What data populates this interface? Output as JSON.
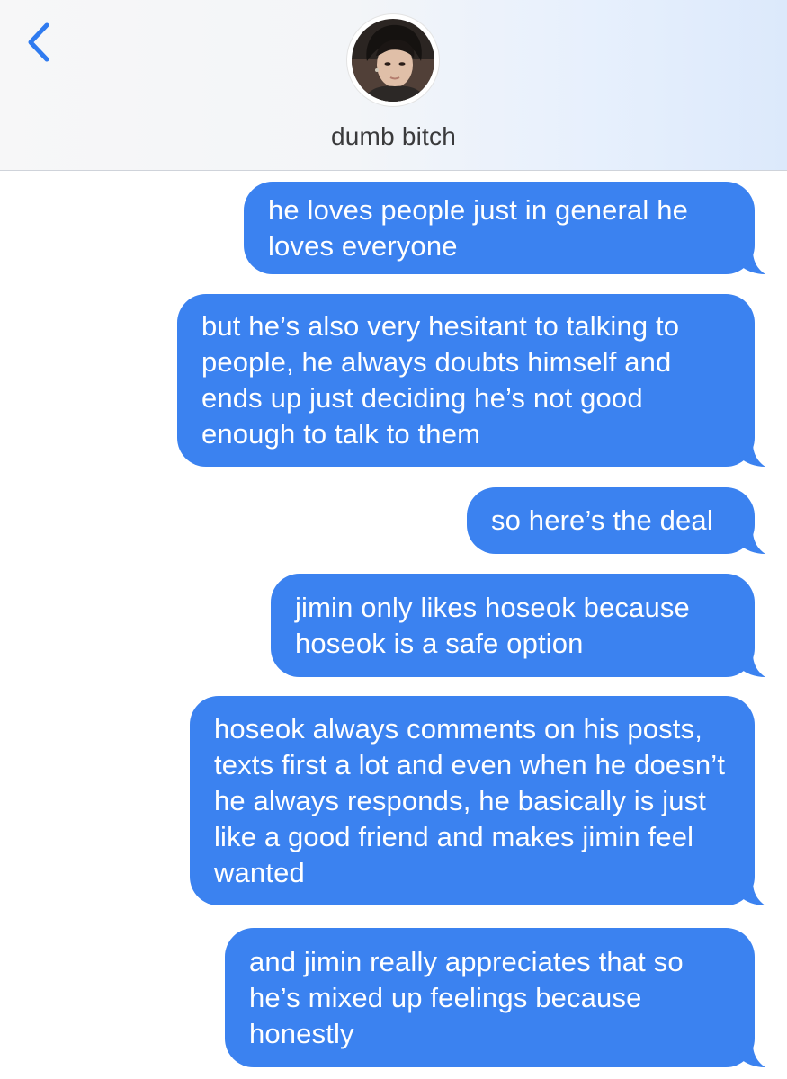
{
  "header": {
    "back_icon": "chevron-left-icon",
    "contact_name": "dumb bitch",
    "avatar_icon": "contact-avatar"
  },
  "colors": {
    "bubble_sent": "#3b82f0",
    "back_chevron": "#2f7bf0",
    "header_bg": "#f3f5f8"
  },
  "messages": [
    {
      "direction": "sent",
      "text": "he loves people just in general he loves everyone"
    },
    {
      "direction": "sent",
      "text": "but he’s also very hesitant to talking to people, he always doubts himself and ends up just deciding he’s not good enough to talk to them"
    },
    {
      "direction": "sent",
      "text": "so here’s the deal"
    },
    {
      "direction": "sent",
      "text": "jimin only likes hoseok because hoseok is a safe option"
    },
    {
      "direction": "sent",
      "text": "hoseok always comments on his posts, texts first a lot and even when he doesn’t he always responds, he basically is just like a good friend and makes jimin feel wanted"
    },
    {
      "direction": "sent",
      "text": "and jimin really appreciates that so he’s mixed up feelings because honestly"
    }
  ]
}
